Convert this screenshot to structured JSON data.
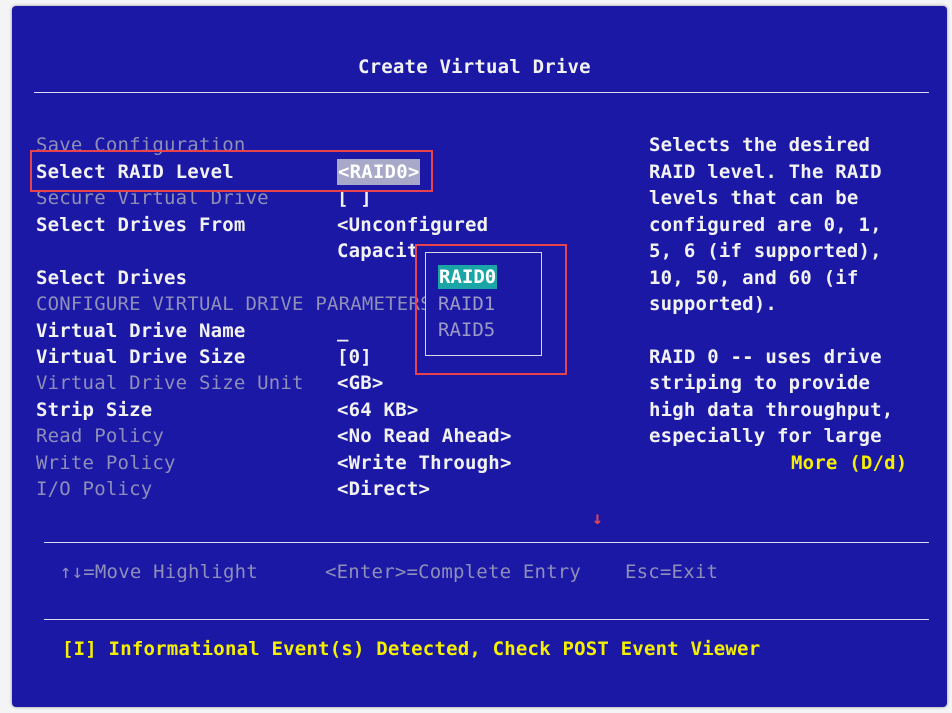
{
  "title": "Create Virtual Drive",
  "form": {
    "save_configuration": "Save Configuration",
    "select_raid_level": "Select RAID Level",
    "select_raid_level_value": "<RAID0>",
    "secure_virtual_drive": "Secure Virtual Drive",
    "secure_virtual_drive_value": "[ ]",
    "select_drives_from": "Select Drives From",
    "select_drives_from_value_line1": "<Unconfigured",
    "select_drives_from_value_line2": "Capacit",
    "select_drives": "Select Drives",
    "configure_params": "CONFIGURE VIRTUAL DRIVE PARAMETERS",
    "virtual_drive_name": "Virtual Drive Name",
    "virtual_drive_name_value": "_",
    "virtual_drive_size": "Virtual Drive Size",
    "virtual_drive_size_value": "[0]",
    "virtual_drive_size_unit": "Virtual Drive Size Unit",
    "virtual_drive_size_unit_value": "<GB>",
    "strip_size": "Strip Size",
    "strip_size_value": "<64 KB>",
    "read_policy": "Read Policy",
    "read_policy_value": "<No Read Ahead>",
    "write_policy": "Write Policy",
    "write_policy_value": "<Write Through>",
    "io_policy": "I/O Policy",
    "io_policy_value": "<Direct>"
  },
  "dropdown": {
    "options": [
      "RAID0",
      "RAID1",
      "RAID5"
    ],
    "selected": "RAID0"
  },
  "help": {
    "lines": [
      "Selects the desired",
      "RAID level. The RAID",
      "levels that can be",
      "configured are 0, 1,",
      "5, 6 (if supported),",
      "10, 50, and 60 (if",
      "supported).",
      "",
      "RAID 0 -- uses drive",
      "striping to provide",
      "high data throughput,",
      "especially for large"
    ],
    "more": "More (D/d)"
  },
  "nav": {
    "move": "↑↓=Move Highlight",
    "enter": "<Enter>=Complete Entry",
    "esc": "Esc=Exit"
  },
  "status": "[I] Informational Event(s) Detected, Check POST Event Viewer",
  "colors": {
    "background": "#1b18a6",
    "highlight_border": "#e8434c",
    "selected_option": "#1aa6a6",
    "status_text": "#f5f000"
  }
}
